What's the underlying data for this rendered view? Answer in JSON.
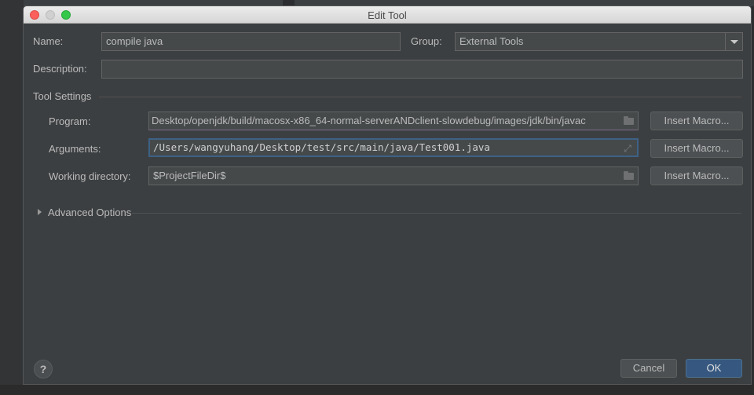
{
  "window": {
    "title": "Edit Tool"
  },
  "form": {
    "name_label": "Name:",
    "name_value": "compile java",
    "group_label": "Group:",
    "group_value": "External Tools",
    "description_label": "Description:",
    "description_value": ""
  },
  "tool_settings": {
    "section_title": "Tool Settings",
    "program_label": "Program:",
    "program_value": "Desktop/openjdk/build/macosx-x86_64-normal-serverANDclient-slowdebug/images/jdk/bin/javac",
    "arguments_label": "Arguments:",
    "arguments_value": "/Users/wangyuhang/Desktop/test/src/main/java/Test001.java",
    "working_dir_label": "Working directory:",
    "working_dir_value": "$ProjectFileDir$",
    "insert_macro_label": "Insert Macro..."
  },
  "advanced": {
    "label": "Advanced Options"
  },
  "footer": {
    "help_label": "?",
    "cancel_label": "Cancel",
    "ok_label": "OK"
  },
  "icons": {
    "expand_arrow": "⤢"
  }
}
